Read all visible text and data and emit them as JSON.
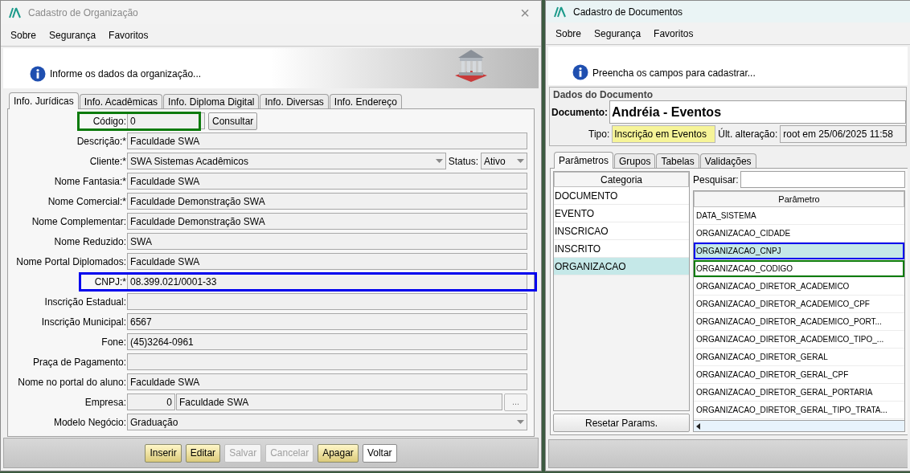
{
  "org_window": {
    "title": "Cadastro de Organização",
    "close": "×",
    "menu": [
      "Sobre",
      "Segurança",
      "Favoritos"
    ],
    "info": "Informe os dados da organização...",
    "tabs": [
      {
        "label": "Info. Jurídicas",
        "selected": true
      },
      {
        "label": "Info. Acadêmicas",
        "selected": false
      },
      {
        "label": "Info. Diploma Digital",
        "selected": false
      },
      {
        "label": "Info. Diversas",
        "selected": false
      },
      {
        "label": "Info. Endereço",
        "selected": false
      }
    ],
    "fields": [
      {
        "kind": "code",
        "label": "Código:",
        "value": "0",
        "button": "Consultar",
        "color": "#0b7a0b"
      },
      {
        "kind": "text",
        "label": "Descrição:*",
        "value": "Faculdade SWA"
      },
      {
        "kind": "client",
        "label": "Cliente:*",
        "value": "SWA Sistemas Acadêmicos",
        "status_label": "Status:",
        "status_value": "Ativo"
      },
      {
        "kind": "text",
        "label": "Nome Fantasia:*",
        "value": "Faculdade SWA"
      },
      {
        "kind": "text",
        "label": "Nome Comercial:*",
        "value": "Faculdade Demonstração SWA"
      },
      {
        "kind": "text",
        "label": "Nome Complementar:",
        "value": "Faculdade Demonstração SWA"
      },
      {
        "kind": "text",
        "label": "Nome Reduzido:",
        "value": "SWA"
      },
      {
        "kind": "text",
        "label": "Nome Portal Diplomados:",
        "value": "Faculdade SWA"
      },
      {
        "kind": "text",
        "label": "CNPJ:*",
        "value": "08.399.021/0001-33",
        "color": "#0000ee"
      },
      {
        "kind": "text",
        "label": "Inscrição Estadual:"
      },
      {
        "kind": "text",
        "label": "Inscrição Municipal:",
        "value": "6567"
      },
      {
        "kind": "text",
        "label": "Fone:",
        "value": "(45)3264-0961"
      },
      {
        "kind": "text",
        "label": "Praça de Pagamento:"
      },
      {
        "kind": "text",
        "label": "Nome no portal do aluno:",
        "value": "Faculdade SWA"
      },
      {
        "kind": "lookup",
        "label": "Empresa:",
        "code": "0",
        "value": "Faculdade SWA",
        "button": "..."
      },
      {
        "kind": "combo",
        "label": "Modelo Negócio:",
        "value": "Graduação"
      }
    ],
    "buttons": [
      {
        "label": "Inserir",
        "disabled": false,
        "primary": true
      },
      {
        "label": "Editar",
        "disabled": false,
        "primary": true
      },
      {
        "label": "Salvar",
        "disabled": true,
        "primary": false
      },
      {
        "label": "Cancelar",
        "disabled": true,
        "primary": false
      },
      {
        "label": "Apagar",
        "disabled": false,
        "primary": true
      },
      {
        "label": "Voltar",
        "disabled": false,
        "primary": false
      }
    ]
  },
  "doc_window": {
    "title": "Cadastro de Documentos",
    "menu": [
      "Sobre",
      "Segurança",
      "Favoritos"
    ],
    "info": "Preencha os campos para cadastrar...",
    "group_title": "Dados do Documento",
    "document_label": "Documento:",
    "document_value": "Andréia - Eventos",
    "type_label": "Tipo:",
    "type_value": "Inscrição em Eventos",
    "changed_label": "Últ. alteração:",
    "changed_value": "root em 25/06/2025 11:58",
    "tabs": [
      {
        "label": "Parâmetros",
        "selected": true
      },
      {
        "label": "Grupos",
        "selected": false
      },
      {
        "label": "Tabelas",
        "selected": false
      },
      {
        "label": "Validações",
        "selected": false
      }
    ],
    "category_header": "Categoria",
    "categories": [
      {
        "label": "DOCUMENTO",
        "selected": false
      },
      {
        "label": "EVENTO",
        "selected": false
      },
      {
        "label": "INSCRICAO",
        "selected": false
      },
      {
        "label": "INSCRITO",
        "selected": false
      },
      {
        "label": "ORGANIZACAO",
        "selected": true
      }
    ],
    "reset_button": "Resetar Params.",
    "search_label": "Pesquisar:",
    "param_header": "Parâmetro",
    "parameters": [
      {
        "label": "DATA_SISTEMA",
        "selected": false
      },
      {
        "label": "ORGANIZACAO_CIDADE",
        "selected": false
      },
      {
        "label": "ORGANIZACAO_CNPJ",
        "selected": true,
        "color": "#0000ee"
      },
      {
        "label": "ORGANIZACAO_CODIGO",
        "selected": false,
        "color": "#0b7a0b"
      },
      {
        "label": "ORGANIZACAO_DIRETOR_ACADEMICO",
        "selected": false
      },
      {
        "label": "ORGANIZACAO_DIRETOR_ACADEMICO_CPF",
        "selected": false
      },
      {
        "label": "ORGANIZACAO_DIRETOR_ACADEMICO_PORT...",
        "selected": false
      },
      {
        "label": "ORGANIZACAO_DIRETOR_ACADEMICO_TIPO_...",
        "selected": false
      },
      {
        "label": "ORGANIZACAO_DIRETOR_GERAL",
        "selected": false
      },
      {
        "label": "ORGANIZACAO_DIRETOR_GERAL_CPF",
        "selected": false
      },
      {
        "label": "ORGANIZACAO_DIRETOR_GERAL_PORTARIA",
        "selected": false
      },
      {
        "label": "ORGANIZACAO_DIRETOR_GERAL_TIPO_TRATA...",
        "selected": false
      }
    ]
  }
}
